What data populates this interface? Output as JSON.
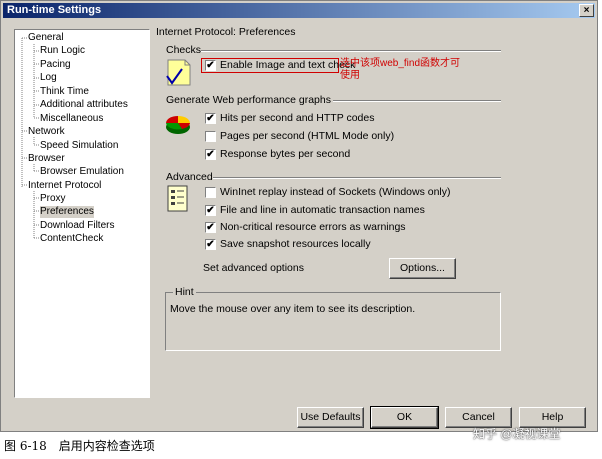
{
  "window": {
    "title": "Run-time Settings",
    "close_label": "×"
  },
  "tree": {
    "items": [
      {
        "label": "General",
        "level": 0
      },
      {
        "label": "Run Logic",
        "level": 1
      },
      {
        "label": "Pacing",
        "level": 1
      },
      {
        "label": "Log",
        "level": 1
      },
      {
        "label": "Think Time",
        "level": 1
      },
      {
        "label": "Additional attributes",
        "level": 1
      },
      {
        "label": "Miscellaneous",
        "level": 1
      },
      {
        "label": "Network",
        "level": 0
      },
      {
        "label": "Speed Simulation",
        "level": 1
      },
      {
        "label": "Browser",
        "level": 0
      },
      {
        "label": "Browser Emulation",
        "level": 1
      },
      {
        "label": "Internet Protocol",
        "level": 0
      },
      {
        "label": "Proxy",
        "level": 1
      },
      {
        "label": "Preferences",
        "level": 1,
        "selected": true
      },
      {
        "label": "Download Filters",
        "level": 1
      },
      {
        "label": "ContentCheck",
        "level": 1
      }
    ]
  },
  "panel": {
    "heading": "Internet Protocol: Preferences",
    "checks": {
      "title": "Checks",
      "enable_image_text": {
        "label": "Enable Image and text check",
        "checked": true
      }
    },
    "graphs": {
      "title": "Generate Web performance graphs",
      "hits": {
        "label": "Hits per second and HTTP codes",
        "checked": true
      },
      "pages": {
        "label": "Pages per second (HTML Mode only)",
        "checked": false
      },
      "bytes": {
        "label": "Response bytes per second",
        "checked": true
      }
    },
    "advanced": {
      "title": "Advanced",
      "wininet": {
        "label": "WinInet replay instead of Sockets (Windows only)",
        "checked": false
      },
      "file_line": {
        "label": "File and line in automatic transaction names",
        "checked": true
      },
      "noncritical": {
        "label": "Non-critical resource errors as warnings",
        "checked": true
      },
      "snapshot": {
        "label": "Save snapshot resources locally",
        "checked": true
      },
      "set_options_label": "Set advanced options",
      "options_button": "Options..."
    },
    "hint": {
      "title": "Hint",
      "text": "Move the mouse over any item to see its description."
    }
  },
  "annotation": {
    "text": "选中该项web_find函数才可使用",
    "color": "#d00000"
  },
  "buttons": {
    "use_defaults": "Use Defaults",
    "ok": "OK",
    "cancel": "Cancel",
    "help": "Help"
  },
  "caption": "图 6-18　启用内容检查选项",
  "watermark": "知乎 @凝视课堂",
  "checkmark": "✔"
}
